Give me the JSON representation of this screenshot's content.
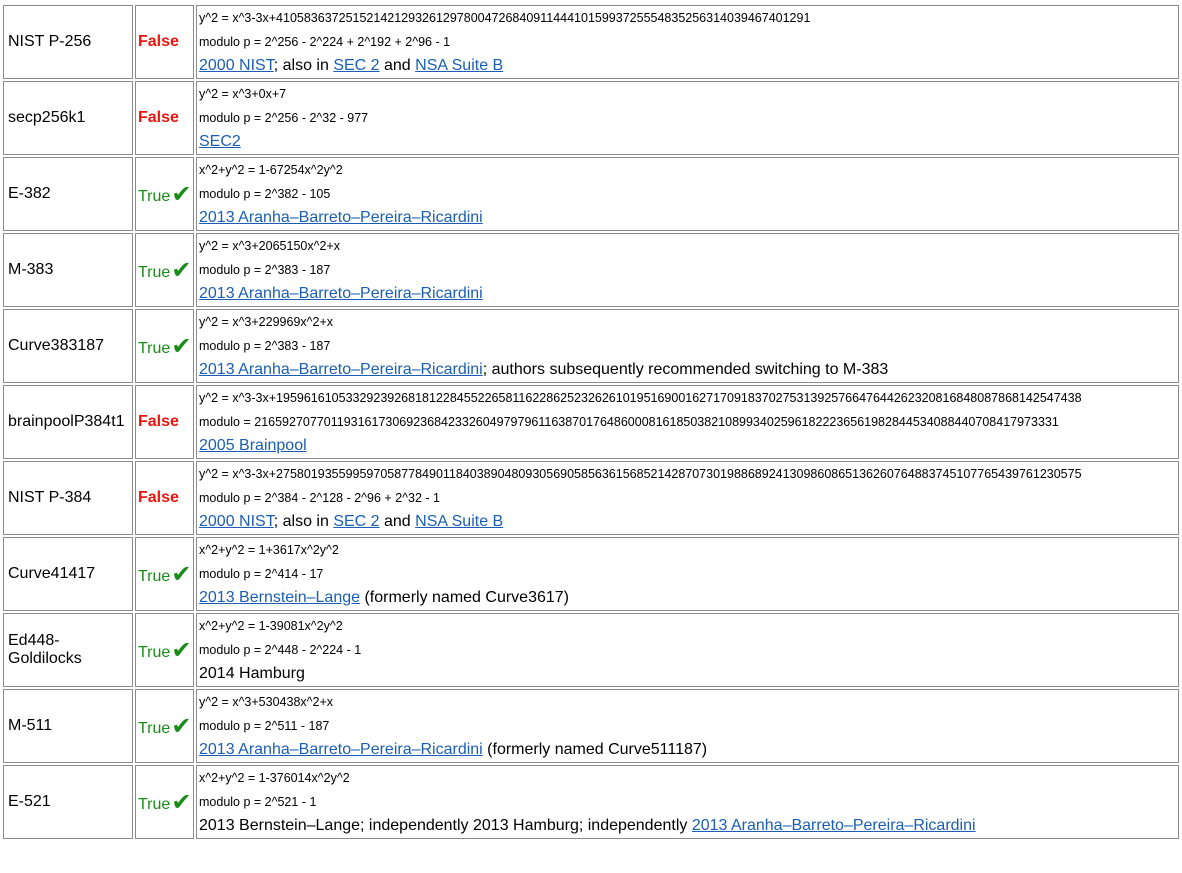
{
  "colors": {
    "false": "#e8170f",
    "true": "#1b8c1b",
    "link": "#1a5fb4"
  },
  "rows": [
    {
      "name": "NIST P-256",
      "safe": false,
      "safe_label": "False",
      "equation": "y^2 = x^3-3x+41058363725152142129326129780047268409114441015993725554835256314039467401291",
      "modulo": "modulo p = 2^256 - 2^224 + 2^192 + 2^96 - 1",
      "source": [
        {
          "text": "2000 NIST",
          "link": true
        },
        {
          "text": "; also in ",
          "link": false
        },
        {
          "text": "SEC 2",
          "link": true
        },
        {
          "text": " and ",
          "link": false
        },
        {
          "text": "NSA Suite B",
          "link": true
        }
      ]
    },
    {
      "name": "secp256k1",
      "safe": false,
      "safe_label": "False",
      "equation": "y^2 = x^3+0x+7",
      "modulo": "modulo p = 2^256 - 2^32 - 977",
      "source": [
        {
          "text": "SEC2",
          "link": true
        }
      ]
    },
    {
      "name": "E-382",
      "safe": true,
      "safe_label": "True",
      "equation": "x^2+y^2 = 1-67254x^2y^2",
      "modulo": "modulo p = 2^382 - 105",
      "source": [
        {
          "text": "2013 Aranha–Barreto–Pereira–Ricardini",
          "link": true
        }
      ]
    },
    {
      "name": "M-383",
      "safe": true,
      "safe_label": "True",
      "equation": "y^2 = x^3+2065150x^2+x",
      "modulo": "modulo p = 2^383 - 187",
      "source": [
        {
          "text": "2013 Aranha–Barreto–Pereira–Ricardini",
          "link": true
        }
      ]
    },
    {
      "name": "Curve383187",
      "safe": true,
      "safe_label": "True",
      "equation": "y^2 = x^3+229969x^2+x",
      "modulo": "modulo p = 2^383 - 187",
      "source": [
        {
          "text": "2013 Aranha–Barreto–Pereira–Ricardini",
          "link": true
        },
        {
          "text": "; authors subsequently recommended switching to M-383",
          "link": false
        }
      ]
    },
    {
      "name": "brainpoolP384t1",
      "safe": false,
      "safe_label": "False",
      "equation": "y^2 = x^3-3x+19596161053329239268181228455226581162286252326261019516900162717091837027531392576647644262320816848087868142547438",
      "modulo": "modulo = 21659270770119316173069236842332604979796116387017648600081618503821089934025961822236561982844534088440708417973331",
      "source": [
        {
          "text": "2005 Brainpool",
          "link": true
        }
      ]
    },
    {
      "name": "NIST P-384",
      "safe": false,
      "safe_label": "False",
      "equation": "y^2 = x^3-3x+27580193559959705877849011840389048093056905856361568521428707301988689241309860865136260764883745107765439761230575",
      "modulo": "modulo p = 2^384 - 2^128 - 2^96 + 2^32 - 1",
      "source": [
        {
          "text": "2000 NIST",
          "link": true
        },
        {
          "text": "; also in ",
          "link": false
        },
        {
          "text": "SEC 2",
          "link": true
        },
        {
          "text": " and ",
          "link": false
        },
        {
          "text": "NSA Suite B",
          "link": true
        }
      ]
    },
    {
      "name": "Curve41417",
      "safe": true,
      "safe_label": "True",
      "equation": "x^2+y^2 = 1+3617x^2y^2",
      "modulo": "modulo p = 2^414 - 17",
      "source": [
        {
          "text": "2013 Bernstein–Lange",
          "link": true
        },
        {
          "text": " (formerly named Curve3617)",
          "link": false
        }
      ]
    },
    {
      "name": "Ed448-Goldilocks",
      "safe": true,
      "safe_label": "True",
      "equation": "x^2+y^2 = 1-39081x^2y^2",
      "modulo": "modulo p = 2^448 - 2^224 - 1",
      "source": [
        {
          "text": "2014 Hamburg",
          "link": false
        }
      ]
    },
    {
      "name": "M-511",
      "safe": true,
      "safe_label": "True",
      "equation": "y^2 = x^3+530438x^2+x",
      "modulo": "modulo p = 2^511 - 187",
      "source": [
        {
          "text": "2013 Aranha–Barreto–Pereira–Ricardini",
          "link": true
        },
        {
          "text": " (formerly named Curve511187)",
          "link": false
        }
      ]
    },
    {
      "name": "E-521",
      "safe": true,
      "safe_label": "True",
      "equation": "x^2+y^2 = 1-376014x^2y^2",
      "modulo": "modulo p = 2^521 - 1",
      "source": [
        {
          "text": "2013 Bernstein–Lange; independently 2013 Hamburg; independently ",
          "link": false
        },
        {
          "text": "2013 Aranha–Barreto–Pereira–Ricardini",
          "link": true
        }
      ]
    }
  ]
}
